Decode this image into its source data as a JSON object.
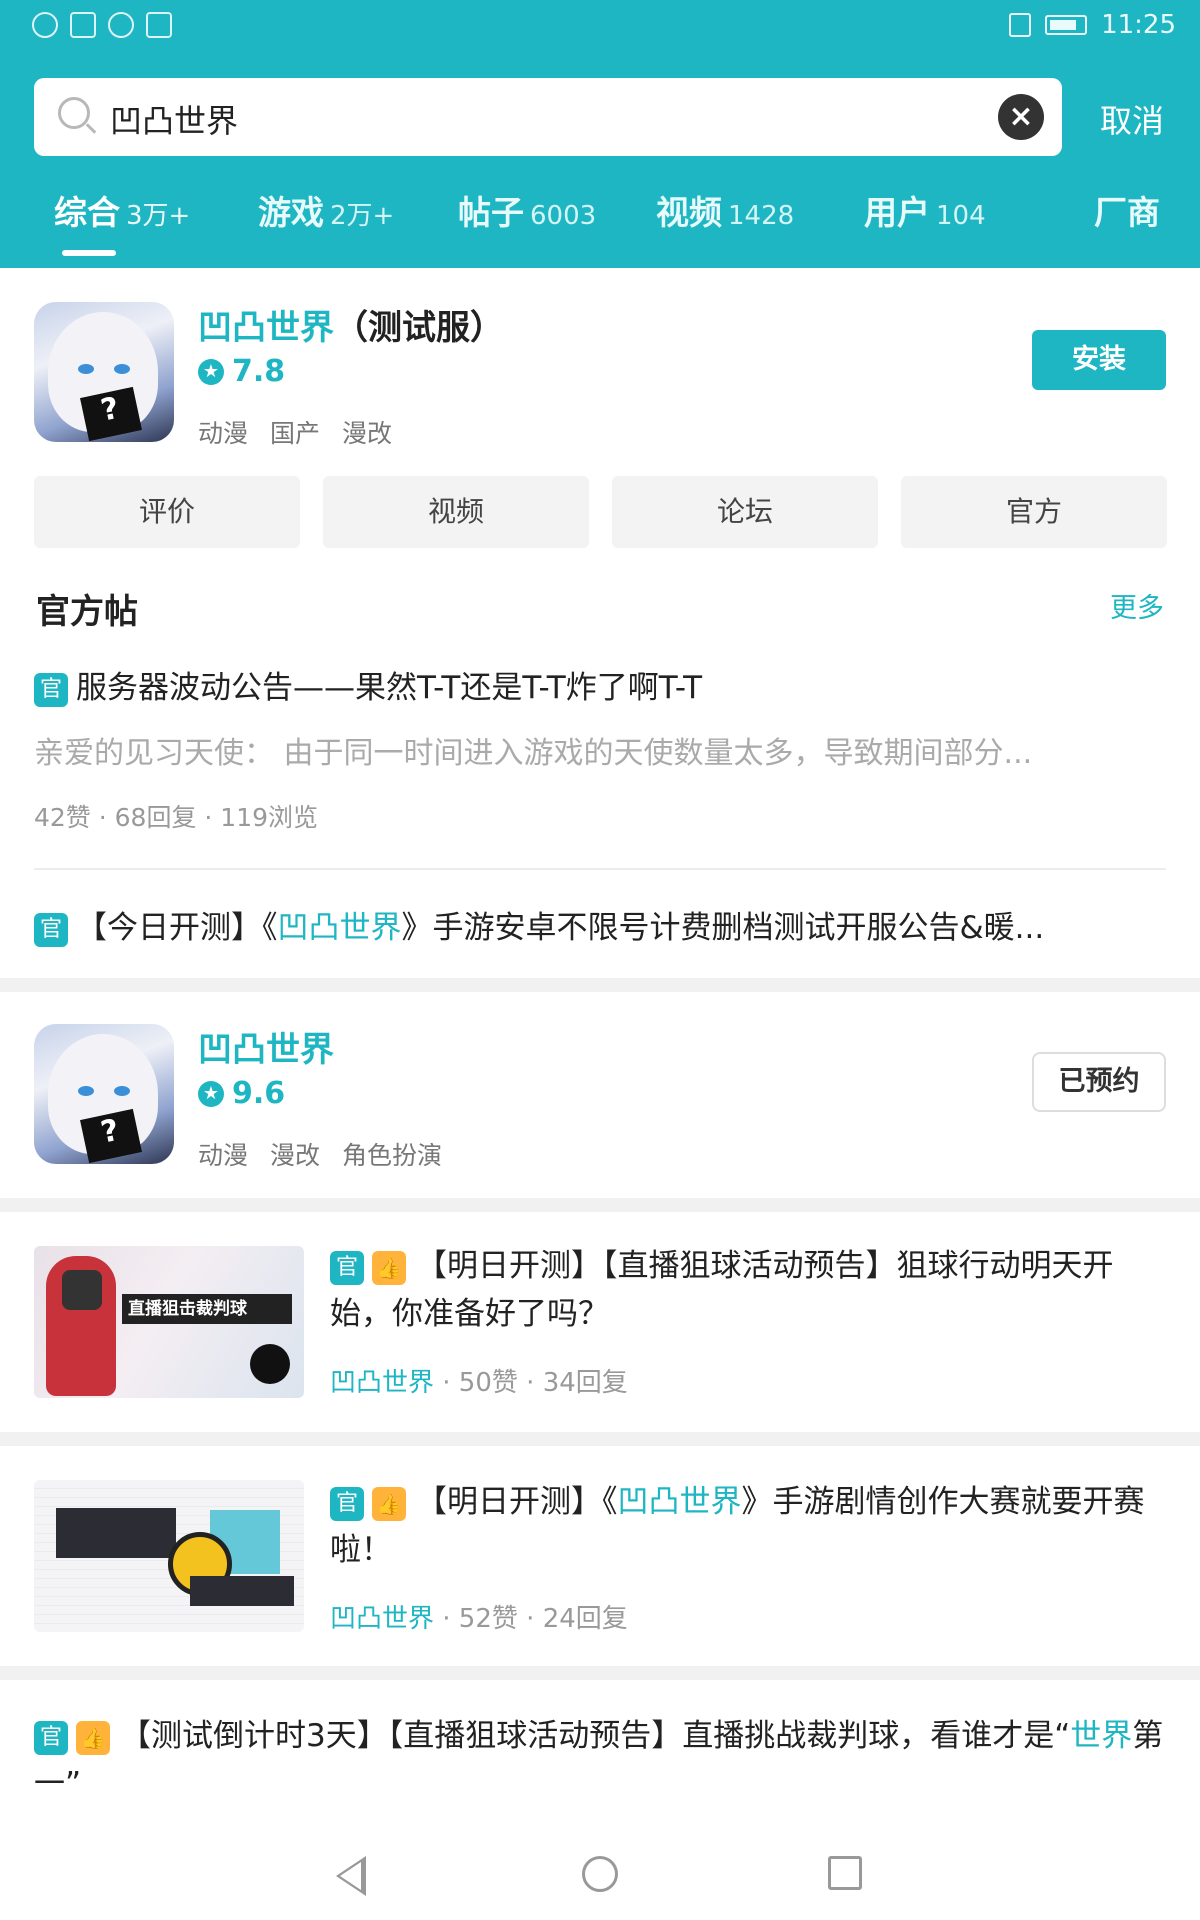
{
  "status": {
    "time": "11:25"
  },
  "search": {
    "query": "凹凸世界",
    "clear_icon": "close-icon",
    "cancel": "取消"
  },
  "tabs": [
    {
      "label": "综合",
      "count": "3万+"
    },
    {
      "label": "游戏",
      "count": "2万+"
    },
    {
      "label": "帖子",
      "count": "6003"
    },
    {
      "label": "视频",
      "count": "1428"
    },
    {
      "label": "用户",
      "count": "104"
    },
    {
      "label": "厂商",
      "count": ""
    }
  ],
  "app1": {
    "title_name": "凹凸世界",
    "title_suffix": "（测试服）",
    "rating": "7.8",
    "tags": [
      "动漫",
      "国产",
      "漫改"
    ],
    "action": "安装",
    "quick_links": [
      "评价",
      "视频",
      "论坛",
      "官方"
    ]
  },
  "official_posts": {
    "section_title": "官方帖",
    "more": "更多",
    "badge": "官",
    "post1": {
      "title": "服务器波动公告——果然T-T还是T-T炸了啊T-T",
      "excerpt": "亲爱的见习天使： 由于同一时间进入游戏的天使数量太多，导致期间部分...",
      "meta": "42赞 · 68回复 · 119浏览"
    },
    "post2": {
      "pre": "【今日开测】《",
      "highlight": "凹凸世界",
      "post": "》手游安卓不限号计费删档测试开服公告&暖..."
    }
  },
  "app2": {
    "title": "凹凸世界",
    "rating": "9.6",
    "tags": [
      "动漫",
      "漫改",
      "角色扮演"
    ],
    "action": "已预约"
  },
  "feed": [
    {
      "badge": "官",
      "hot": "赞",
      "title": "【明日开测】【直播狙球活动预告】狙球行动明天开始，你准备好了吗？",
      "thumb_text": "直播狙击裁判球",
      "source": "凹凸世界",
      "meta": " · 50赞 · 34回复"
    },
    {
      "badge": "官",
      "hot": "赞",
      "title_pre": "【明日开测】《",
      "title_highlight": "凹凸世界",
      "title_post": "》手游剧情创作大赛就要开赛啦！",
      "source": "凹凸世界",
      "meta": " · 52赞 · 24回复"
    },
    {
      "badge": "官",
      "hot": "赞",
      "title_pre": "【测试倒计时3天】【直播狙球活动预告】直播挑战裁判球，看谁才是“",
      "title_highlight": "世界",
      "title_post": "第一”"
    }
  ],
  "colors": {
    "accent": "#1fb6c3",
    "hot": "#ffb33a"
  }
}
